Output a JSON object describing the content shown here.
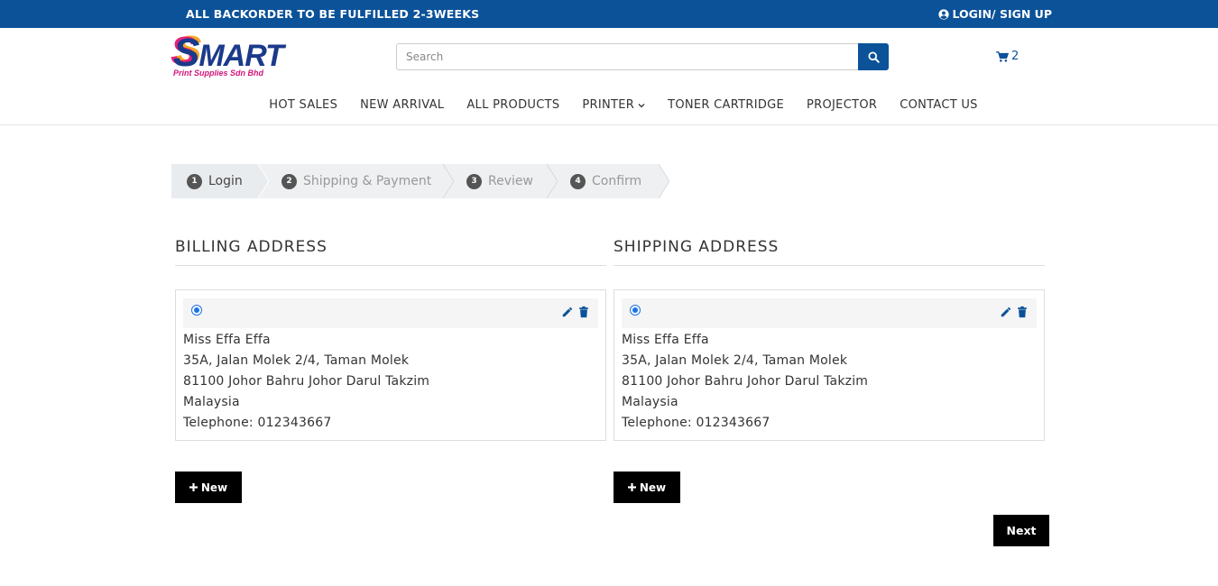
{
  "topbar": {
    "notice": "ALL BACKORDER TO BE FULFILLED 2-3WEEKS",
    "login_label": "LOGIN/ SIGN UP",
    "background": "#0b5299"
  },
  "logo": {
    "word_first": "S",
    "word_rest": "MART",
    "tagline": "Print Supplies Sdn Bhd"
  },
  "search": {
    "placeholder": "Search"
  },
  "cart": {
    "count": "2"
  },
  "nav": {
    "items": [
      "HOT SALES",
      "NEW ARRIVAL",
      "ALL PRODUCTS",
      "PRINTER",
      "TONER CARTRIDGE",
      "PROJECTOR",
      "CONTACT US"
    ]
  },
  "steps": [
    {
      "num": "1",
      "label": "Login"
    },
    {
      "num": "2",
      "label": "Shipping & Payment"
    },
    {
      "num": "3",
      "label": "Review"
    },
    {
      "num": "4",
      "label": "Confirm"
    }
  ],
  "billing": {
    "title": "BILLING ADDRESS",
    "address": {
      "name": "Miss Effa Effa",
      "line1": "35A, Jalan Molek 2/4, Taman Molek",
      "line2": "81100 Johor Bahru Johor Darul Takzim",
      "country": "Malaysia",
      "telephone": "Telephone: 012343667"
    },
    "new_label": "New"
  },
  "shipping": {
    "title": "SHIPPING ADDRESS",
    "address": {
      "name": "Miss Effa Effa",
      "line1": "35A, Jalan Molek 2/4, Taman Molek",
      "line2": "81100 Johor Bahru Johor Darul Takzim",
      "country": "Malaysia",
      "telephone": "Telephone: 012343667"
    },
    "new_label": "New"
  },
  "next_label": "Next",
  "colors": {
    "brand": "#0b5299",
    "button": "#000000"
  }
}
